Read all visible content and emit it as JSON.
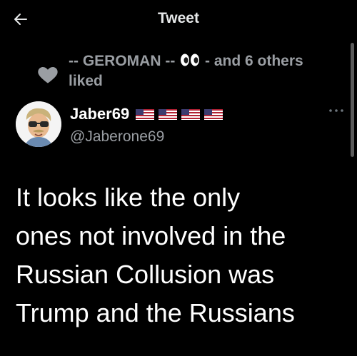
{
  "header": {
    "title": "Tweet",
    "back_icon": "arrow-left-icon"
  },
  "social_context": {
    "icon": "heart-icon",
    "prefix": "-- GEROMAN -- ",
    "emoji": "eyes",
    "suffix": " - and 6 others liked"
  },
  "author": {
    "name": "Jaber69",
    "flags": [
      "us-flag",
      "us-flag",
      "us-flag",
      "us-flag"
    ],
    "handle": "@Jaberone69"
  },
  "tweet": {
    "text": "It looks like the only\nones not involved in the\nRussian Collusion was\nTrump and the Russians"
  },
  "colors": {
    "background": "#000000",
    "primary_text": "#ffffff",
    "secondary_text": "#9a9ea3"
  }
}
